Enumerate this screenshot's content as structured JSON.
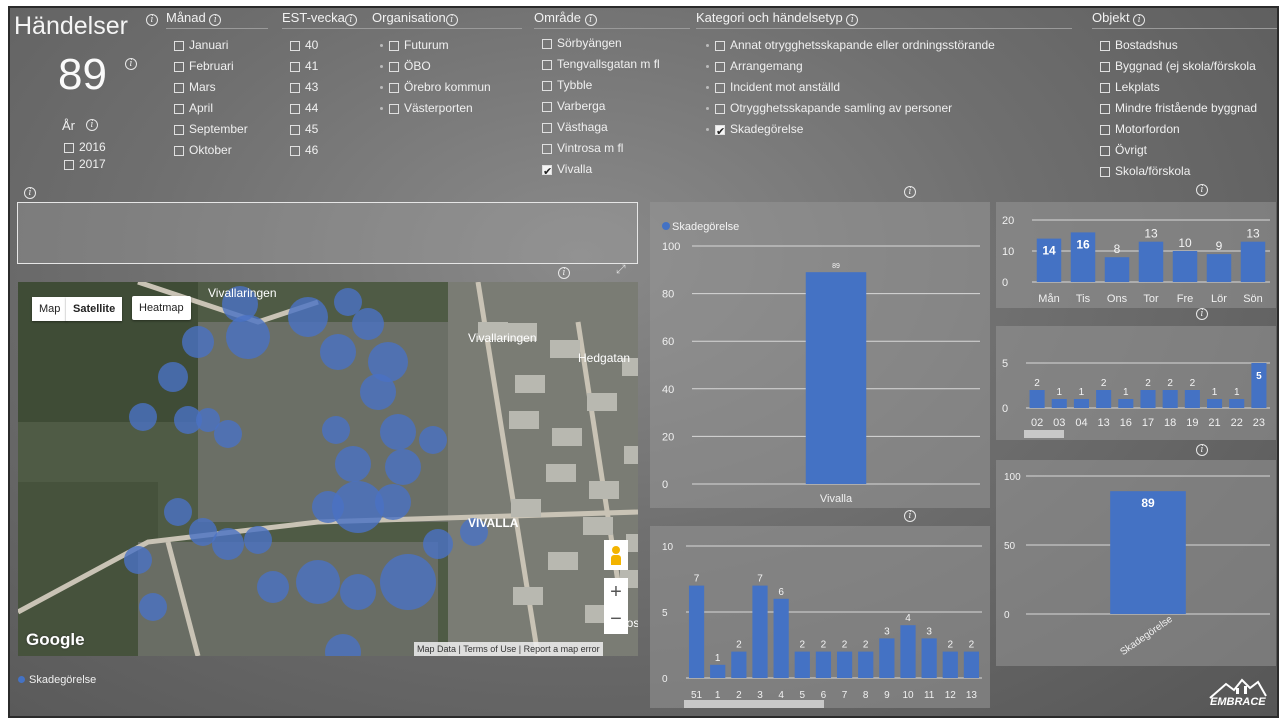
{
  "header": {
    "title": "Händelser",
    "count": "89",
    "year_label": "År",
    "years": [
      {
        "label": "2016",
        "checked": false
      },
      {
        "label": "2017",
        "checked": false
      }
    ]
  },
  "slicers": {
    "month": {
      "title": "Månad",
      "items": [
        {
          "label": "Januari",
          "checked": false
        },
        {
          "label": "Februari",
          "checked": false
        },
        {
          "label": "Mars",
          "checked": false
        },
        {
          "label": "April",
          "checked": false
        },
        {
          "label": "September",
          "checked": false
        },
        {
          "label": "Oktober",
          "checked": false
        }
      ]
    },
    "week": {
      "title": "EST-vecka",
      "items": [
        {
          "label": "40",
          "checked": false
        },
        {
          "label": "41",
          "checked": false
        },
        {
          "label": "43",
          "checked": false
        },
        {
          "label": "44",
          "checked": false
        },
        {
          "label": "45",
          "checked": false
        },
        {
          "label": "46",
          "checked": false
        }
      ]
    },
    "organisation": {
      "title": "Organisation",
      "items": [
        {
          "label": "Futurum",
          "checked": false
        },
        {
          "label": "ÖBO",
          "checked": false
        },
        {
          "label": "Örebro kommun",
          "checked": false
        },
        {
          "label": "Västerporten",
          "checked": false
        }
      ]
    },
    "area": {
      "title": "Område",
      "items": [
        {
          "label": "Sörbyängen",
          "checked": false
        },
        {
          "label": "Tengvallsgatan m fl",
          "checked": false
        },
        {
          "label": "Tybble",
          "checked": false
        },
        {
          "label": "Varberga",
          "checked": false
        },
        {
          "label": "Västhaga",
          "checked": false
        },
        {
          "label": "Vintrosa m fl",
          "checked": false
        },
        {
          "label": "Vivalla",
          "checked": true
        }
      ]
    },
    "category": {
      "title": "Kategori och händelsetyp",
      "items": [
        {
          "label": "Annat otrygghetsskapande eller ordningsstörande",
          "checked": false
        },
        {
          "label": "Arrangemang",
          "checked": false
        },
        {
          "label": "Incident mot anställd",
          "checked": false
        },
        {
          "label": "Otrygghetsskapande samling av personer",
          "checked": false
        },
        {
          "label": "Skadegörelse",
          "checked": true
        }
      ]
    },
    "object": {
      "title": "Objekt",
      "items": [
        {
          "label": "Bostadshus",
          "checked": false
        },
        {
          "label": "Byggnad (ej skola/förskola",
          "checked": false
        },
        {
          "label": "Lekplats",
          "checked": false
        },
        {
          "label": "Mindre fristående byggnad",
          "checked": false
        },
        {
          "label": "Motorfordon",
          "checked": false
        },
        {
          "label": "Övrigt",
          "checked": false
        },
        {
          "label": "Skola/förskola",
          "checked": false
        }
      ]
    }
  },
  "map": {
    "btn_map": "Map",
    "btn_satellite": "Satellite",
    "btn_heatmap": "Heatmap",
    "google": "Google",
    "footer": [
      "Map Data",
      "Terms of Use",
      "Report a map error"
    ],
    "labels": [
      "Vivallaringen",
      "Vivallaringen",
      "Vivallaringen",
      "Hedgatan",
      "VIVALLA",
      "Eurosto"
    ],
    "legend": "Skadegörelse",
    "colors": {
      "bubble": "#4a72c4"
    }
  },
  "charts": {
    "main_legend": "Skadegörelse",
    "accent": "#4472c4"
  },
  "branding": {
    "logo_text": "EMBRACE"
  },
  "chart_data": [
    {
      "type": "bar",
      "title": "",
      "legend": [
        "Skadegörelse"
      ],
      "categories": [
        "Vivalla"
      ],
      "values": [
        89
      ],
      "yticks": [
        0,
        20,
        40,
        60,
        80,
        100
      ],
      "ylim": [
        0,
        100
      ]
    },
    {
      "type": "bar",
      "title": "",
      "categories": [
        "51",
        "1",
        "2",
        "3",
        "4",
        "5",
        "6",
        "7",
        "8",
        "9",
        "10",
        "11",
        "12",
        "13"
      ],
      "values": [
        7,
        1,
        2,
        7,
        6,
        2,
        2,
        2,
        2,
        3,
        4,
        3,
        2,
        2
      ],
      "yticks": [
        0,
        5,
        10
      ],
      "ylim": [
        0,
        10
      ]
    },
    {
      "type": "bar",
      "title": "",
      "categories": [
        "Mån",
        "Tis",
        "Ons",
        "Tor",
        "Fre",
        "Lör",
        "Sön"
      ],
      "values": [
        14,
        16,
        8,
        13,
        10,
        9,
        13
      ],
      "yticks": [
        0,
        10,
        20
      ],
      "ylim": [
        0,
        20
      ]
    },
    {
      "type": "bar",
      "title": "",
      "categories": [
        "02",
        "03",
        "04",
        "13",
        "16",
        "17",
        "18",
        "19",
        "21",
        "22",
        "23"
      ],
      "values": [
        2,
        1,
        1,
        2,
        1,
        2,
        2,
        2,
        1,
        1,
        5
      ],
      "yticks": [
        0,
        5
      ],
      "ylim": [
        0,
        6
      ]
    },
    {
      "type": "bar",
      "title": "",
      "categories": [
        "Skadegörelse"
      ],
      "values": [
        89
      ],
      "yticks": [
        0,
        50,
        100
      ],
      "ylim": [
        0,
        100
      ]
    }
  ]
}
